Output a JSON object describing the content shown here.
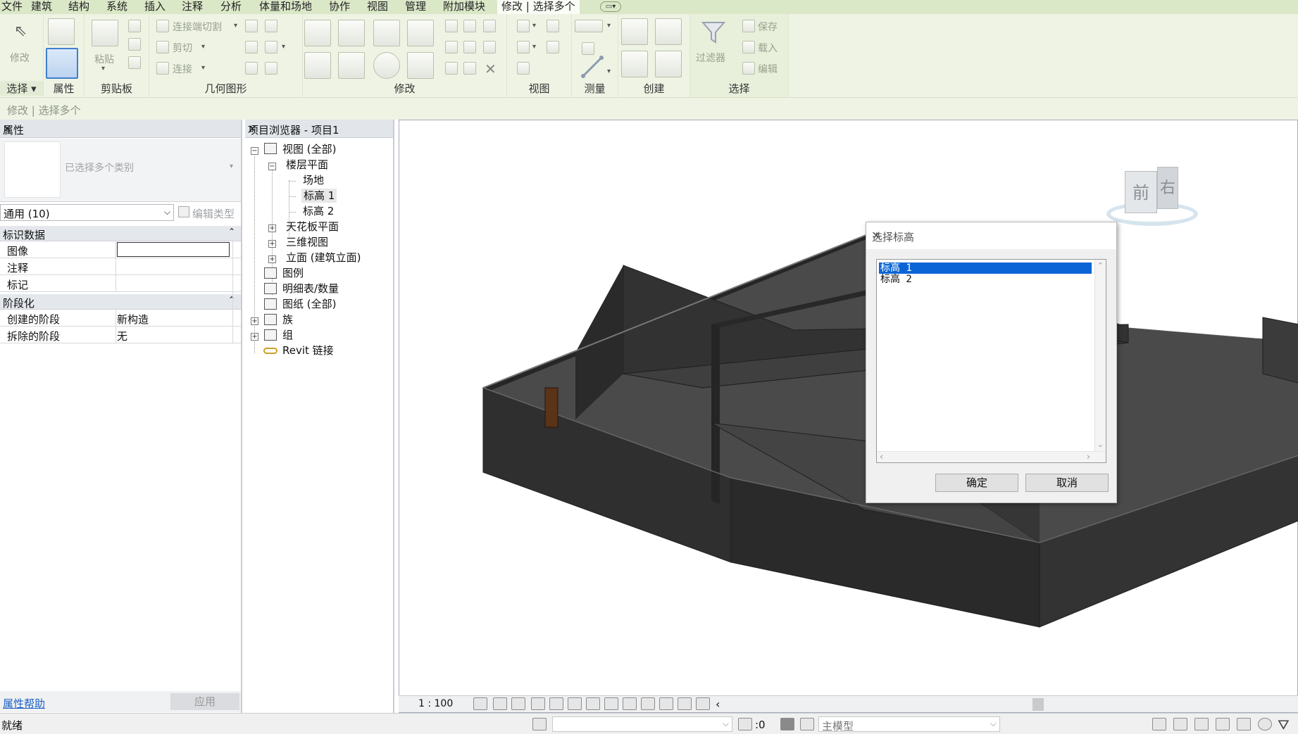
{
  "menu": {
    "items": [
      "文件",
      "建筑",
      "结构",
      "系统",
      "插入",
      "注释",
      "分析",
      "体量和场地",
      "协作",
      "视图",
      "管理",
      "附加模块"
    ],
    "active_tab": "修改 | 选择多个",
    "extra_icon": "quick-access-dropdown-icon"
  },
  "ribbon": {
    "panels": {
      "select": "选择",
      "properties": "属性",
      "clipboard": "剪贴板",
      "geometry": "几何图形",
      "modify": "修改",
      "view": "视图",
      "measure": "测量",
      "create": "创建",
      "selection": "选择"
    },
    "labels": {
      "modify": "修改",
      "paste": "粘贴",
      "cope": "连接端切割",
      "cut": "剪切",
      "join": "连接",
      "filter": "过滤器",
      "save": "保存",
      "load": "载入",
      "edit": "编辑"
    }
  },
  "options_bar": {
    "text": "修改 | 选择多个"
  },
  "properties": {
    "title": "属性",
    "type_selector": "已选择多个类别",
    "filter_value": "通用 (10)",
    "edit_type": "编辑类型",
    "sections": [
      {
        "name": "标识数据",
        "rows": [
          {
            "key": "图像",
            "value": ""
          },
          {
            "key": "注释",
            "value": ""
          },
          {
            "key": "标记",
            "value": ""
          }
        ]
      },
      {
        "name": "阶段化",
        "rows": [
          {
            "key": "创建的阶段",
            "value": "新构造"
          },
          {
            "key": "拆除的阶段",
            "value": "无"
          }
        ]
      }
    ],
    "help_link": "属性帮助",
    "apply_button": "应用"
  },
  "browser": {
    "title": "项目浏览器 - 项目1",
    "nodes": {
      "views_all": "视图 (全部)",
      "floor_plans": "楼层平面",
      "site": "场地",
      "level1": "标高 1",
      "level2": "标高 2",
      "ceiling_plans": "天花板平面",
      "view_3d": "三维视图",
      "elevations": "立面 (建筑立面)",
      "legends": "图例",
      "schedules": "明细表/数量",
      "sheets": "图纸 (全部)",
      "families": "族",
      "groups": "组",
      "revit_links": "Revit 链接"
    }
  },
  "viewport": {
    "viewcube_front": "前",
    "viewcube_right": "右",
    "scale": "1 : 100"
  },
  "dialog": {
    "title": "选择标高",
    "items": [
      "标高 1",
      "标高 2"
    ],
    "selected_index": 0,
    "ok": "确定",
    "cancel": "取消"
  },
  "status": {
    "ready": "就绪",
    "count": ":0",
    "model": "主模型"
  },
  "colors": {
    "ribbon_bg": "#eef3e4",
    "menubar_bg": "#dbe8c8",
    "selection_blue": "#0a64d6",
    "wall_dark": "#2f2f2f",
    "floor_gray": "#4a4a4a",
    "door_brown": "#5a3318"
  }
}
